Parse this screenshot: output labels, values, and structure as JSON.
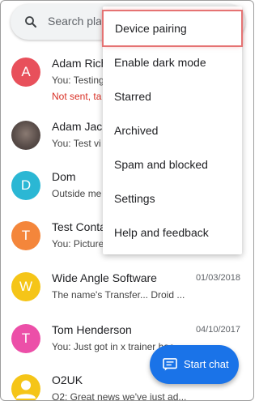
{
  "search": {
    "placeholder": "Search pla"
  },
  "conversations": [
    {
      "initial": "A",
      "name": "Adam Rich",
      "snippet": "You: Testing",
      "status": "Not sent, ta",
      "date": "",
      "avatar_color": "#e8505b"
    },
    {
      "initial": "",
      "name": "Adam Jac",
      "snippet": "You: Test vi",
      "status": "",
      "date": "",
      "avatar_color": "#6d5c55"
    },
    {
      "initial": "D",
      "name": "Dom",
      "snippet": "Outside me",
      "status": "",
      "date": "",
      "avatar_color": "#2bb7d4"
    },
    {
      "initial": "T",
      "name": "Test Conta",
      "snippet": "You: Picture",
      "status": "",
      "date": "",
      "avatar_color": "#f4863b"
    },
    {
      "initial": "W",
      "name": "Wide Angle Software",
      "snippet": "The name's Transfer... Droid ...",
      "status": "",
      "date": "01/03/2018",
      "avatar_color": "#f5c518"
    },
    {
      "initial": "T",
      "name": "Tom Henderson",
      "snippet": "You: Just got in x trainer hac",
      "status": "",
      "date": "04/10/2017",
      "avatar_color": "#ec4fa8"
    },
    {
      "initial": "",
      "name": "O2UK",
      "snippet": "O2: Great news we've just ad...",
      "status": "",
      "date": "",
      "avatar_color": "#f5c518"
    }
  ],
  "menu": {
    "items": [
      "Device pairing",
      "Enable dark mode",
      "Starred",
      "Archived",
      "Spam and blocked",
      "Settings",
      "Help and feedback"
    ]
  },
  "fab": {
    "label": "Start chat",
    "color": "#1a73e8"
  },
  "icons": {
    "search": "search-icon",
    "fab": "message-icon",
    "person": "person-icon"
  }
}
